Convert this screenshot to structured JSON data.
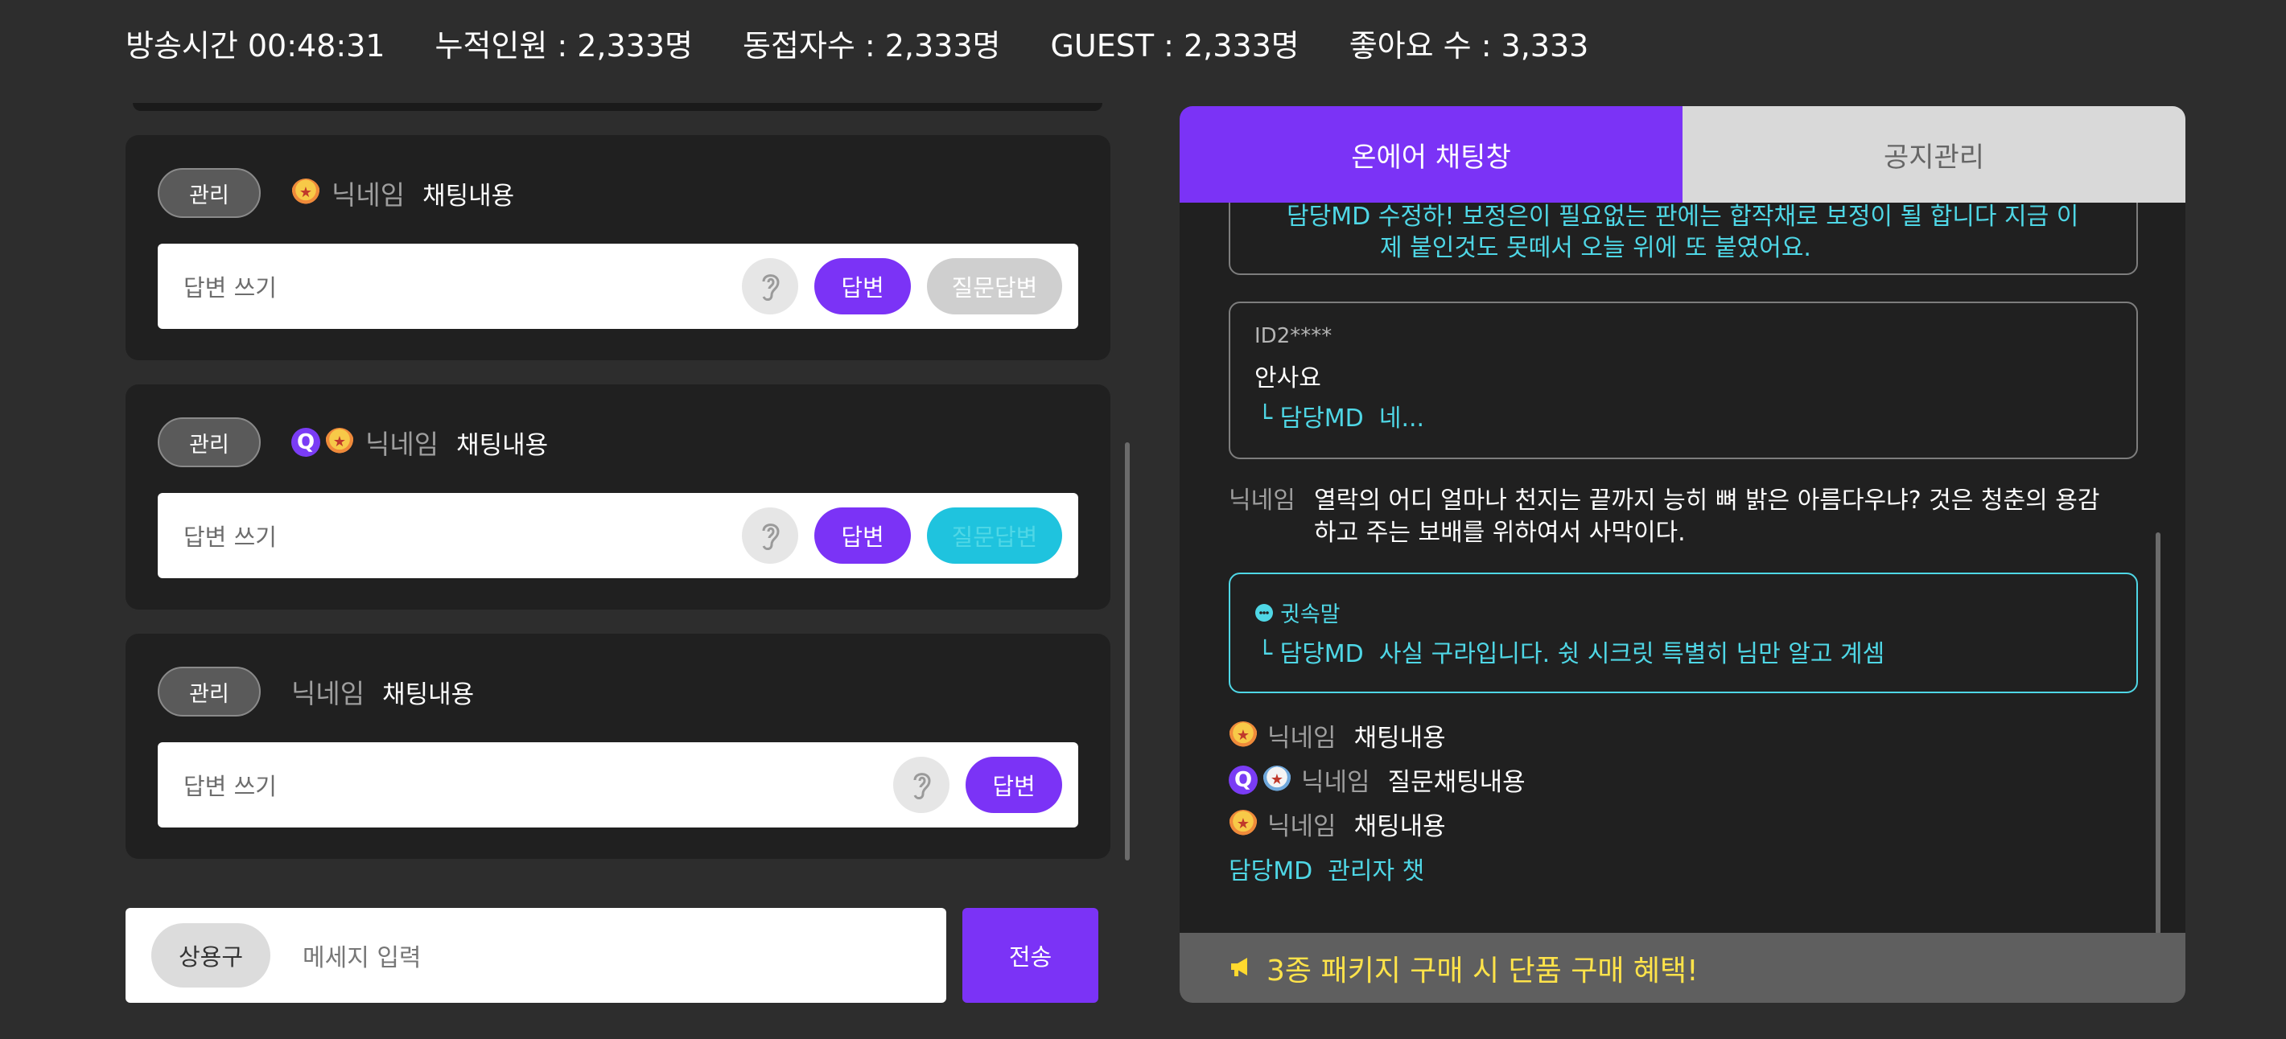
{
  "stats": {
    "broadcast_time_label": "방송시간",
    "broadcast_time_value": "00:48:31",
    "cumulative_label": "누적인원 :",
    "cumulative_value": "2,333명",
    "concurrent_label": "동접자수 :",
    "concurrent_value": "2,333명",
    "guest_label": "GUEST :",
    "guest_value": "2,333명",
    "likes_label": "좋아요 수 :",
    "likes_value": "3,333"
  },
  "cards": [
    {
      "manage": "관리",
      "nickname": "닉네임",
      "content": "채팅내용",
      "placeholder": "답변 쓰기",
      "answer": "답변",
      "qa": "질문답변"
    },
    {
      "manage": "관리",
      "q_badge": "Q",
      "nickname": "닉네임",
      "content": "채팅내용",
      "placeholder": "답변 쓰기",
      "answer": "답변",
      "qa": "질문답변"
    },
    {
      "manage": "관리",
      "nickname": "닉네임",
      "content": "채팅내용",
      "placeholder": "답변 쓰기",
      "answer": "답변"
    }
  ],
  "composer": {
    "phrase_button": "상용구",
    "placeholder": "메세지 입력",
    "send": "전송"
  },
  "right": {
    "tabs": [
      "온에어 채팅창",
      "공지관리"
    ],
    "partial_box": {
      "top_line": "담당MD  수정하! 보정은이 필요없는 판에는 합작채로 보정이 될 합니다 지금 이",
      "second_line": "제 붙인것도 못떼서 오늘 위에 또 붙였어요."
    },
    "box2": {
      "id": "ID2****",
      "text": "안사요",
      "reply_prefix": "└ 담당MD",
      "reply": "네..."
    },
    "long_msg": {
      "nickname": "닉네임",
      "line1": "열락의 어디 얼마나 천지는 끝까지 능히 뼈 밝은 아름다우냐? 것은 청춘의 용감",
      "line2": "하고 주는 보배를 위하여서 사막이다."
    },
    "whisper": {
      "title": "귓속말",
      "reply_prefix": "└ 담당MD",
      "reply": "사실 구라입니다. 쉿 시크릿 특별히 님만 알고 계셈"
    },
    "lines": [
      {
        "nickname": "닉네임",
        "content": "채팅내용"
      },
      {
        "q_badge": "Q",
        "nickname": "닉네임",
        "content": "질문채팅내용"
      },
      {
        "nickname": "닉네임",
        "content": "채팅내용"
      }
    ],
    "admin_line": {
      "label": "담당MD",
      "content": "관리자 챗"
    },
    "notice": "3종 패키지 구매 시 단품 구매 혜택!"
  }
}
